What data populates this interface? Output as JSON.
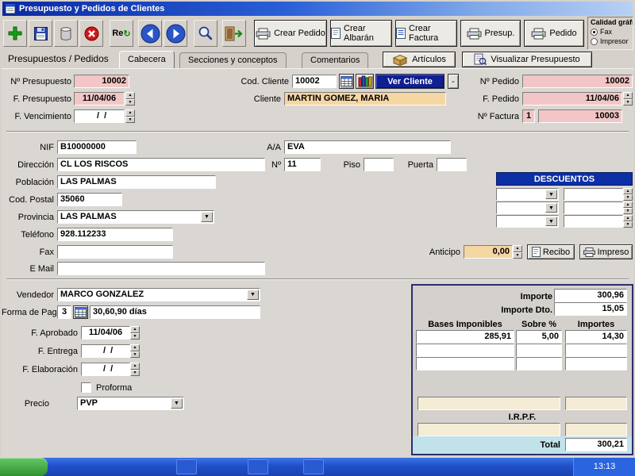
{
  "window": {
    "title": "Presupuesto y Pedidos de Clientes"
  },
  "toolbar": {
    "refresh_label": "Re",
    "crear_pedido": "Crear Pedido",
    "crear_albaran": "Crear Albarán",
    "crear_factura": "Crear Factura",
    "presup": "Presup.",
    "pedido": "Pedido",
    "calidad": {
      "label": "Calidad gráfic",
      "fax": "Fax",
      "impresor": "Impresor",
      "fax_selected": true
    }
  },
  "tabs": {
    "caption": "Presupuestos / Pedidos",
    "cabecera": "Cabecera",
    "secciones": "Secciones y conceptos",
    "comentarios": "Comentarios",
    "articulos": "Artículos",
    "visualizar": "Visualizar Presupuesto"
  },
  "header": {
    "n_presupuesto_label": "Nº Presupuesto",
    "n_presupuesto": "10002",
    "f_presupuesto_label": "F. Presupuesto",
    "f_presupuesto": "11/04/06",
    "f_vencimiento_label": "F. Vencimiento",
    "f_vencimiento": "  /  /",
    "cod_cliente_label": "Cod. Cliente",
    "cod_cliente": "10002",
    "ver_cliente": "Ver Cliente",
    "minus": "-",
    "cliente_label": "Cliente",
    "cliente": "MARTIN GOMEZ, MARIA",
    "n_pedido_label": "Nº Pedido",
    "n_pedido": "10002",
    "f_pedido_label": "F. Pedido",
    "f_pedido": "11/04/06",
    "n_factura_label": "Nº Factura",
    "n_factura_serie": "1",
    "n_factura": "10003"
  },
  "address": {
    "nif_label": "NIF",
    "nif": "B10000000",
    "aa_label": "A/A",
    "aa": "EVA",
    "direccion_label": "Dirección",
    "direccion": "CL LOS RISCOS",
    "numero_label": "Nº",
    "numero": "11",
    "piso_label": "Piso",
    "piso": "",
    "puerta_label": "Puerta",
    "puerta": "",
    "poblacion_label": "Población",
    "poblacion": "LAS PALMAS",
    "cod_postal_label": "Cod. Postal",
    "cod_postal": "35060",
    "provincia_label": "Provincia",
    "provincia": "LAS PALMAS",
    "telefono_label": "Teléfono",
    "telefono": "928.112233",
    "fax_label": "Fax",
    "fax": "",
    "email_label": "E Mail",
    "email": ""
  },
  "descuentos": {
    "title": "DESCUENTOS"
  },
  "anticipo": {
    "label": "Anticipo",
    "value": "0,00",
    "recibo": "Recibo",
    "impreso": "Impreso"
  },
  "condiciones": {
    "vendedor_label": "Vendedor",
    "vendedor": "MARCO GONZALEZ",
    "forma_pago_label": "Forma de Pago",
    "forma_pago_codigo": "3",
    "forma_pago": "30,60,90 días",
    "f_aprobado_label": "F. Aprobado",
    "f_aprobado": "11/04/06",
    "f_entrega_label": "F. Entrega",
    "f_entrega": "  /  /",
    "f_elaboracion_label": "F. Elaboración",
    "f_elaboracion": "  /  /",
    "proforma_label": "Proforma",
    "proforma_checked": false,
    "precio_label": "Precio",
    "precio": "PVP"
  },
  "totals": {
    "importe_label": "Importe",
    "importe": "300,96",
    "importe_dto_label": "Importe Dto.",
    "importe_dto": "15,05",
    "col_bases": "Bases Imponibles",
    "col_sobre": "Sobre %",
    "col_importes": "Importes",
    "rows": [
      {
        "base": "285,91",
        "sobre": "5,00",
        "importe": "14,30"
      },
      {
        "base": "",
        "sobre": "",
        "importe": ""
      },
      {
        "base": "",
        "sobre": "",
        "importe": ""
      }
    ],
    "irpf_label": "I.R.P.F.",
    "total_label": "Total",
    "total": "300,21"
  },
  "taskbar": {
    "clock": "13:13"
  }
}
